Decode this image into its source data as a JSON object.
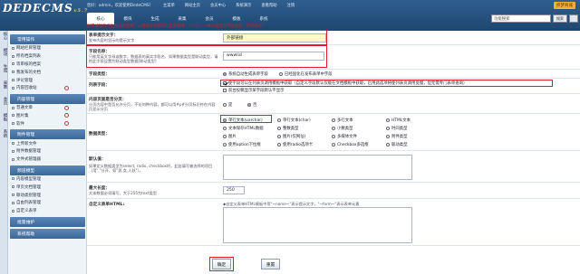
{
  "app": {
    "logo": "DEDECMS",
    "version": "v5.7"
  },
  "topbar": {
    "links": [
      "您好：admin，欢迎使用DedeCMS！",
      "主菜单",
      "网站主页",
      "会员中心",
      "系统演示",
      "查看帮助",
      "注销"
    ],
    "upgrade": "织梦商城"
  },
  "tabs": [
    "核心",
    "模块",
    "生成",
    "采集",
    "会员",
    "模板",
    "系统"
  ],
  "search": {
    "placeholder": "功能搜索",
    "button": "搜索",
    "advanced": "高级"
  },
  "sidebar": {
    "vtabs": [
      "核心",
      "模块",
      "生成",
      "采集",
      "会员",
      "模板",
      "系统"
    ],
    "groups": [
      {
        "title": "常用操作",
        "items": [
          "网站栏目管理",
          "所有档案列表",
          "等审核的档案",
          "我发布的文档",
          "评论管理",
          "内容回收站"
        ]
      },
      {
        "title": "内容管理",
        "items": [
          "普通文章",
          "图片集",
          "软件"
        ]
      },
      {
        "title": "附件管理",
        "items": [
          "上传新文件",
          "附件数据管理",
          "文件式管理器"
        ]
      },
      {
        "title": "频道模型",
        "items": [
          "内容模型管理",
          "单页文档管理",
          "联动类别管理",
          "自由列表管理",
          "自定义表单"
        ]
      },
      {
        "title": "批量维护",
        "items": []
      },
      {
        "title": "系统帮助",
        "items": []
      }
    ]
  },
  "notice": "附属编辑的元数据已经使用，以便部分字段可以正常调用：'<?> -- 一种对指定为字段类型，不可修改！'",
  "form": {
    "prompt_label": "表单提示文字：",
    "prompt_desc": "发布内容时显示的提示文字",
    "prompt_value": "外部链接",
    "fieldname_label": "字段名称：",
    "fieldname_desc": "只能用英文字母或数字，数据表的真实字段名，如果数据类型是联动类型，请把此字段设置为联动类型数据[联动类型]",
    "fieldname_value": "wwwlid",
    "fieldtype_label": "字段类型：",
    "fieldtype_opt1": "系统自动生成表单字段",
    "fieldtype_opt2": "已经固化在发布表单中字段",
    "list_label": "列表字段：",
    "list_opt1": "使字段可以在列表页调用模板中获取（自定义字段默认仅能在文档模板中获取，启用此选项将使列表页调用变慢，但无需专门表单查询）",
    "list_opt2": "前台投稿显示某字段默认不显示",
    "allow_label": "内容页面是否分页：",
    "allow_desc": "分页内容中是否允许分页，不论何种内容，都可以用#p#分页标识符在内容页显示分页",
    "allow_yes": "是",
    "allow_no": "否",
    "datatype_label": "数据类型：",
    "datatypes": [
      "单行文本(varchar)",
      "单行文本(char)",
      "多行文本",
      "HTML文本",
      "文本保存HTML数据",
      "整数类型",
      "小数类型",
      "时间类型",
      "图片",
      "图片(仅网址)",
      "多媒体文件",
      "附件类型",
      "使用option下拉框",
      "使用radio选项卡",
      "Checkbox多选框",
      "联动类型"
    ],
    "default_label": "默认值：",
    "default_desc": "如果定义数据类型为select, radio, checkbox时，此处填写被选择的项目（用\",\"分开，如\"男,女,人妖\"）。",
    "maxlen_label": "最大长度：",
    "maxlen_desc": "文本数据必须填写，大于255为text类型",
    "maxlen_value": "250",
    "custom_label": "自定义表单HTML:",
    "custom_desc": "◆自定义表单HTML模板中用\"~name~\"表示提示文字，\"~form~\"表示表单元素",
    "submit": "确定",
    "reset": "重置"
  }
}
